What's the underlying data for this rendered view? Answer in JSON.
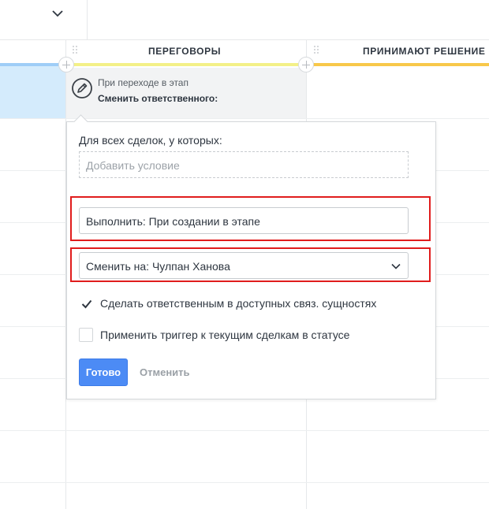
{
  "columns": [
    {
      "title": "",
      "bar_color": "#9fcdf7"
    },
    {
      "title": "ПЕРЕГОВОРЫ",
      "bar_color": "#f3f088"
    },
    {
      "title": "ПРИНИМАЮТ РЕШЕНИЕ",
      "bar_color": "#f8c84a"
    }
  ],
  "top_left": {
    "icon": "chevron-down-icon"
  },
  "trigger": {
    "subtitle": "При переходе в этап",
    "action": "Сменить ответственного:",
    "icon": "edit-icon"
  },
  "panel": {
    "condition_label": "Для всех сделок, у которых:",
    "condition_placeholder": "Добавить условие",
    "execute_value": "Выполнить: При создании в этапе",
    "change_to_value": "Сменить на: Чулпан Ханова",
    "checkbox1": {
      "label": "Сделать ответственным в доступных связ. сущностях",
      "checked": true
    },
    "checkbox2": {
      "label": "Применить триггер к текущим сделкам в статусе",
      "checked": false
    },
    "done_label": "Готово",
    "cancel_label": "Отменить"
  },
  "colors": {
    "primary": "#4c8bf5",
    "highlight": "#e01c1c",
    "selected_cell": "#d4ebfc"
  }
}
